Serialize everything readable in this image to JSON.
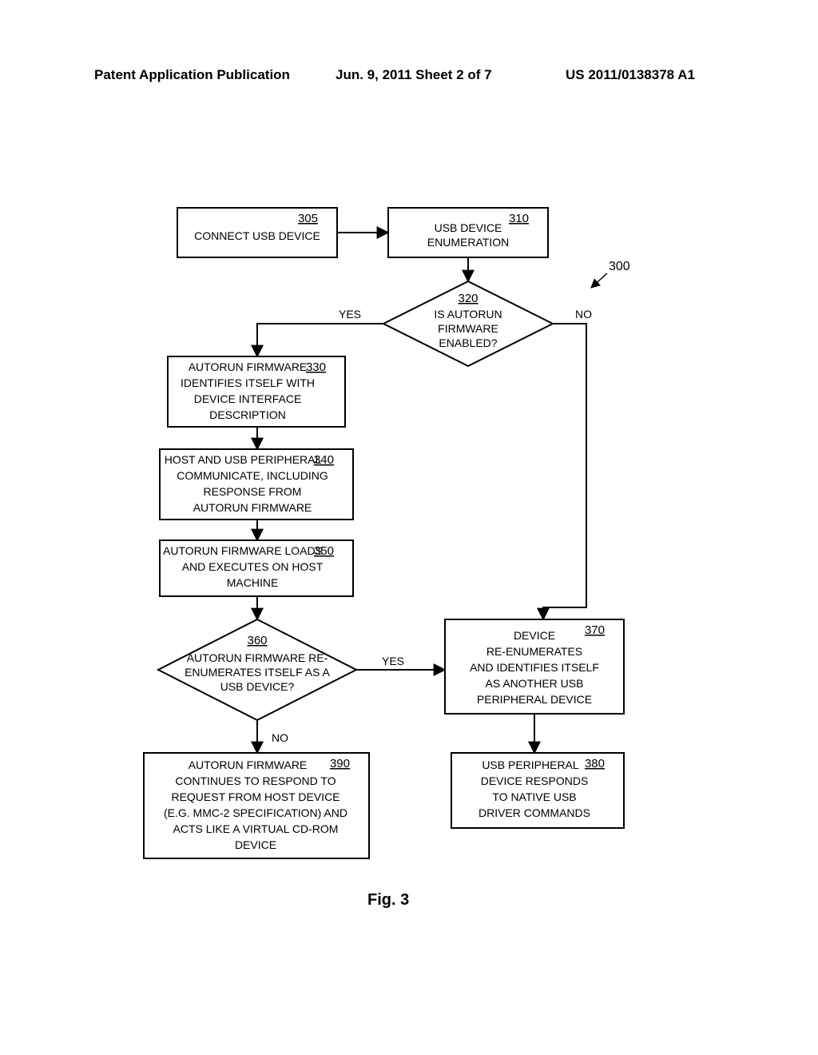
{
  "header": {
    "left": "Patent Application Publication",
    "center": "Jun. 9, 2011  Sheet 2 of 7",
    "right": "US 2011/0138378 A1"
  },
  "figure_caption": "Fig. 3",
  "diagram_label": "300",
  "edges": {
    "yes": "YES",
    "no": "NO"
  },
  "nodes": {
    "n305": {
      "ref": "305",
      "text": "CONNECT USB DEVICE"
    },
    "n310": {
      "ref": "310",
      "l1": "USB DEVICE",
      "l2": "ENUMERATION"
    },
    "n320": {
      "ref": "320",
      "l1": "IS AUTORUN",
      "l2": "FIRMWARE",
      "l3": "ENABLED?"
    },
    "n330": {
      "ref": "330",
      "l1": "AUTORUN FIRMWARE",
      "l2": "IDENTIFIES ITSELF WITH",
      "l3": "DEVICE INTERFACE",
      "l4": "DESCRIPTION"
    },
    "n340": {
      "ref": "340",
      "l1": "HOST AND USB PERIPHERAL",
      "l2": "COMMUNICATE, INCLUDING",
      "l3": "RESPONSE FROM",
      "l4": "AUTORUN FIRMWARE"
    },
    "n350": {
      "ref": "350",
      "l1": "AUTORUN FIRMWARE LOADS",
      "l2": "AND EXECUTES ON HOST",
      "l3": "MACHINE"
    },
    "n360": {
      "ref": "360",
      "l1": "AUTORUN FIRMWARE RE-",
      "l2": "ENUMERATES ITSELF AS A",
      "l3": "USB DEVICE?"
    },
    "n370": {
      "ref": "370",
      "l1": "DEVICE",
      "l2": "RE-ENUMERATES",
      "l3": "AND IDENTIFIES ITSELF",
      "l4": "AS ANOTHER USB",
      "l5": "PERIPHERAL DEVICE"
    },
    "n380": {
      "ref": "380",
      "l1": "USB PERIPHERAL",
      "l2": "DEVICE RESPONDS",
      "l3": "TO NATIVE USB",
      "l4": "DRIVER COMMANDS"
    },
    "n390": {
      "ref": "390",
      "l1": "AUTORUN FIRMWARE",
      "l2": "CONTINUES TO RESPOND TO",
      "l3": "REQUEST FROM HOST DEVICE",
      "l4": "(E.G. MMC-2 SPECIFICATION) AND",
      "l5": "ACTS LIKE A VIRTUAL CD-ROM",
      "l6": "DEVICE"
    }
  }
}
